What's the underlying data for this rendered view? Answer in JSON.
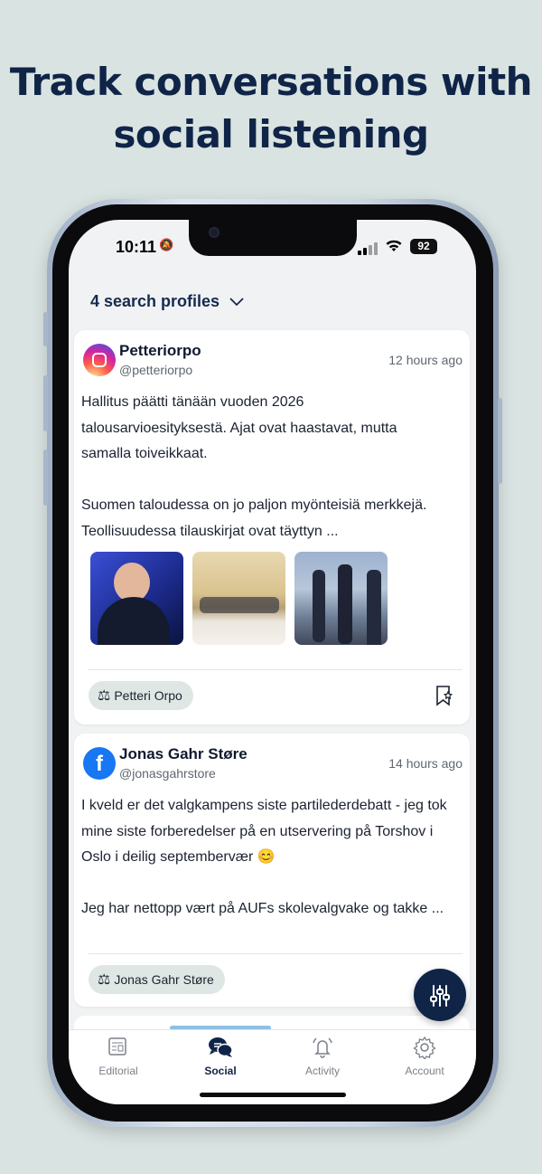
{
  "headline": {
    "line1": "Track conversations with",
    "line2": "social listening"
  },
  "status_bar": {
    "time": "10:11",
    "battery": "92"
  },
  "search_profiles": {
    "label": "4 search profiles"
  },
  "posts": [
    {
      "network": "instagram",
      "author": "Petteriorpo",
      "handle": "@petteriorpo",
      "time_ago": "12 hours ago",
      "text_lines": [
        "Hallitus päätti tänään vuoden 2026",
        "talousarvioesityksestä. Ajat ovat haastavat, mutta",
        "samalla toiveikkaat.",
        "",
        "Suomen taloudessa on jo paljon myönteisiä merkkejä.",
        "Teollisuudessa tilauskirjat ovat täyttyn  ..."
      ],
      "images": [
        "press-briefing-photo",
        "meeting-room-photo",
        "press-conference-photo"
      ],
      "tag": "Petteri Orpo"
    },
    {
      "network": "facebook",
      "author": "Jonas Gahr Støre",
      "handle": "@jonasgahrstore",
      "time_ago": "14 hours ago",
      "text_lines": [
        "I kveld er det valgkampens siste partilederdebatt - jeg tok",
        "mine siste forberedelser på en utservering på Torshov i",
        "Oslo i deilig septembervær 😊",
        "",
        "Jeg har nettopp vært på AUFs skolevalgvake og takke  ..."
      ],
      "tag": "Jonas Gahr Støre"
    }
  ],
  "tabs": [
    {
      "label": "Editorial",
      "icon": "newspaper-icon",
      "active": false
    },
    {
      "label": "Social",
      "icon": "chat-bubbles-icon",
      "active": true
    },
    {
      "label": "Activity",
      "icon": "bell-icon",
      "active": false
    },
    {
      "label": "Account",
      "icon": "gear-icon",
      "active": false
    }
  ]
}
